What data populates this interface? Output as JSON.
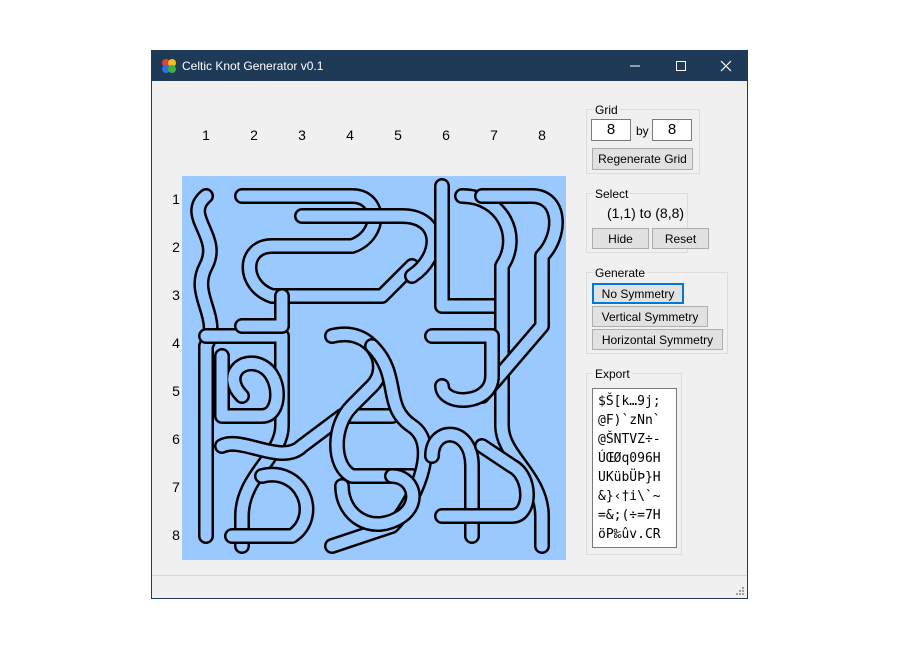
{
  "window": {
    "title": "Celtic Knot Generator v0.1"
  },
  "titlebar": {
    "icon": "app-icon",
    "minimize_icon": "minimize-icon",
    "maximize_icon": "maximize-icon",
    "close_icon": "close-icon"
  },
  "canvas": {
    "columns": [
      "1",
      "2",
      "3",
      "4",
      "5",
      "6",
      "7",
      "8"
    ],
    "rows": [
      "1",
      "2",
      "3",
      "4",
      "5",
      "6",
      "7",
      "8"
    ],
    "background": "#99c9ff",
    "strand_color": "#99c9ff",
    "outline_color": "#000000"
  },
  "grid": {
    "label": "Grid",
    "width": "8",
    "by_label": "by",
    "height": "8",
    "regenerate_label": "Regenerate Grid"
  },
  "select": {
    "label": "Select",
    "range_text": "(1,1) to (8,8)",
    "hide_label": "Hide",
    "reset_label": "Reset"
  },
  "generate": {
    "label": "Generate",
    "no_symmetry_label": "No Symmetry",
    "vertical_label": "Vertical Symmetry",
    "horizontal_label": "Horizontal Symmetry"
  },
  "export": {
    "label": "Export",
    "text": "$Š[k…9j;\n@F)`zNn`\n@ŠNTVZ÷-\nÚŒØq096H\nUKübÜÞ}H\n&}‹†i\\`~\n=&;(÷=7H\nöP‰ûv.CR"
  },
  "accent_color": "#0078d7",
  "titlebar_color": "#1f3a57"
}
